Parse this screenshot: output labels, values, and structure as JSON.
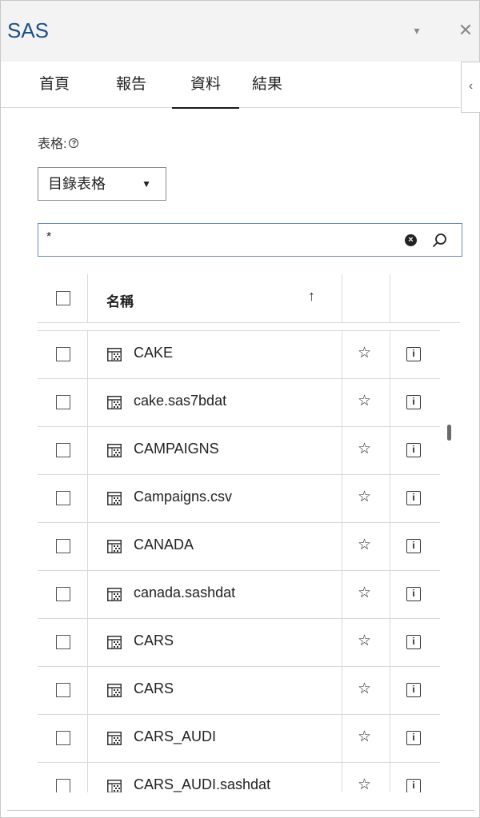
{
  "app": {
    "title": "SAS"
  },
  "tabs": [
    {
      "label": "首頁",
      "active": false
    },
    {
      "label": "報告",
      "active": false
    },
    {
      "label": "資料",
      "active": true
    },
    {
      "label": "結果",
      "active": false
    }
  ],
  "collapse_glyph": "‹",
  "dropdown_glyph": "▾",
  "close_glyph": "✕",
  "table_selector": {
    "label": "表格:",
    "help_glyph": "?",
    "selected": "目錄表格",
    "caret": "▼"
  },
  "search": {
    "value": "*",
    "clear_glyph": "×"
  },
  "grid": {
    "header_name": "名稱",
    "sort_glyph": "↑",
    "rows": [
      {
        "name": "CAKE"
      },
      {
        "name": "cake.sas7bdat"
      },
      {
        "name": "CAMPAIGNS"
      },
      {
        "name": "Campaigns.csv"
      },
      {
        "name": "CANADA"
      },
      {
        "name": "canada.sashdat"
      },
      {
        "name": "CARS"
      },
      {
        "name": "CARS"
      },
      {
        "name": "CARS_AUDI"
      },
      {
        "name": "CARS_AUDI.sashdat"
      }
    ]
  },
  "icons": {
    "star": "☆",
    "info": "i"
  },
  "colors": {
    "title": "#1c4f86",
    "search_border": "#6a8bb1"
  }
}
